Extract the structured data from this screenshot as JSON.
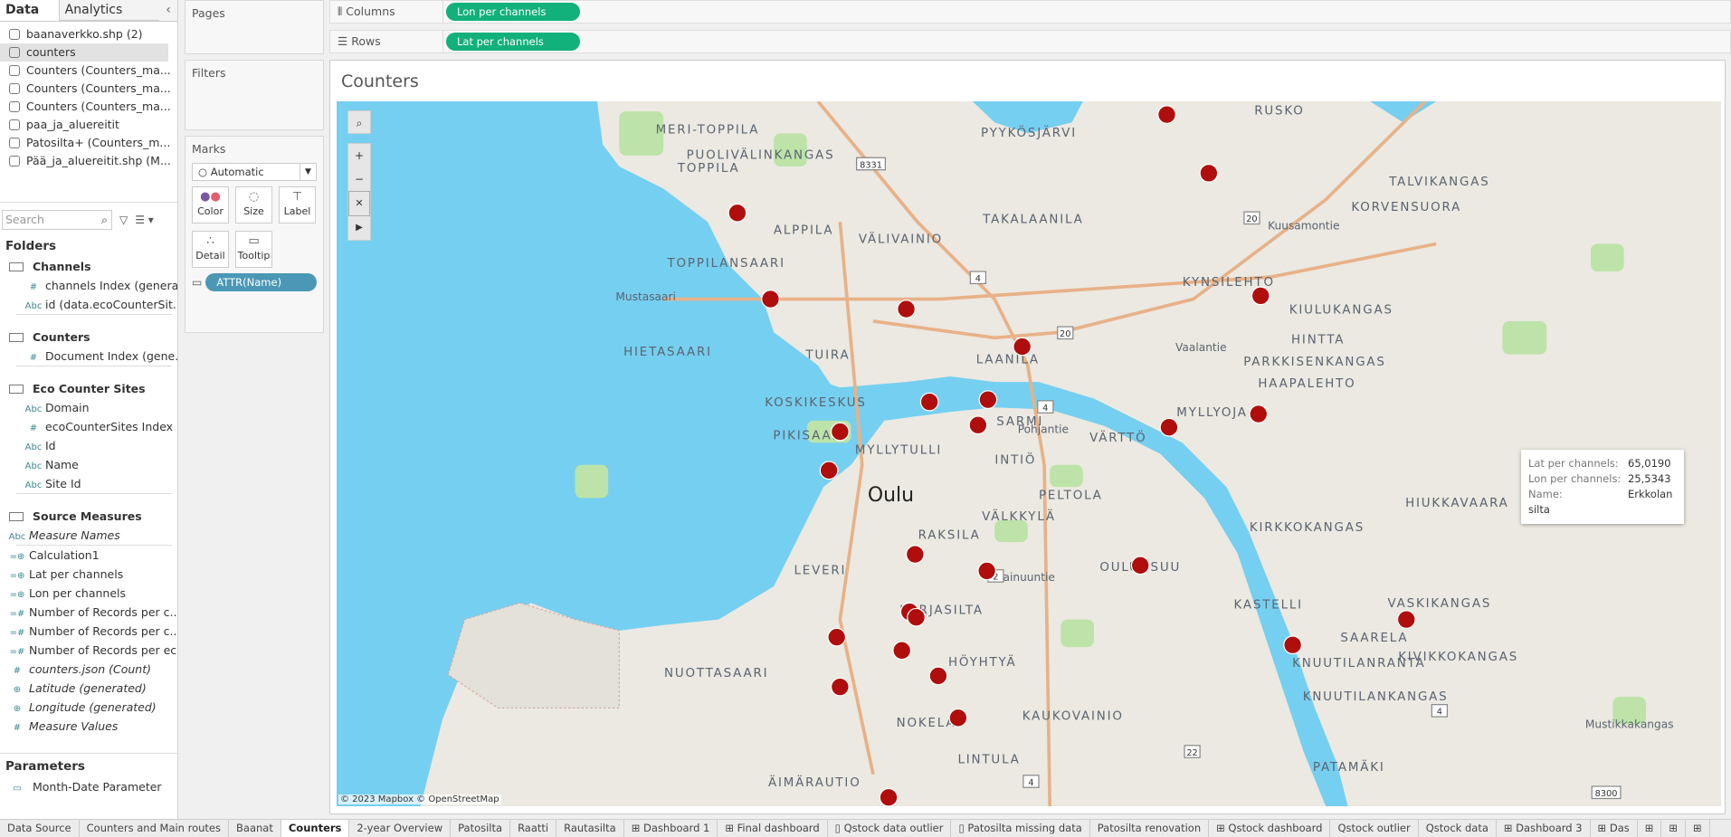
{
  "left": {
    "tabs": {
      "data": "Data",
      "analytics": "Analytics"
    },
    "datasources": [
      "baanaverkko.shp (2)",
      "counters",
      "Counters (Counters_ma...",
      "Counters (Counters_ma...",
      "Counters (Counters_ma...",
      "paa_ja_aluereitit",
      "Patosilta+ (Counters_m...",
      "Pää_ja_aluereitit.shp (M..."
    ],
    "search_placeholder": "Search",
    "folders_title": "Folders",
    "channels": {
      "name": "Channels",
      "fields": [
        {
          "type": "#",
          "name": "channels Index (genera..."
        },
        {
          "type": "Abc",
          "name": "id (data.ecoCounterSit..."
        }
      ]
    },
    "counters": {
      "name": "Counters",
      "fields": [
        {
          "type": "#",
          "name": "Document Index (gene..."
        }
      ]
    },
    "eco": {
      "name": "Eco Counter Sites",
      "fields": [
        {
          "type": "Abc",
          "name": "Domain"
        },
        {
          "type": "#",
          "name": "ecoCounterSites Index ..."
        },
        {
          "type": "Abc",
          "name": "Id"
        },
        {
          "type": "Abc",
          "name": "Name"
        },
        {
          "type": "Abc",
          "name": "Site Id"
        }
      ]
    },
    "source": {
      "name": "Source Measures",
      "measure_names": "Measure Names",
      "fields": [
        {
          "type": "=⊕",
          "name": "Calculation1"
        },
        {
          "type": "=⊕",
          "name": "Lat per channels"
        },
        {
          "type": "=⊕",
          "name": "Lon per channels"
        },
        {
          "type": "=#",
          "name": "Number of Records per c..."
        },
        {
          "type": "=#",
          "name": "Number of Records per c..."
        },
        {
          "type": "=#",
          "name": "Number of Records per ec..."
        },
        {
          "type": "#",
          "name": "counters.json (Count)"
        },
        {
          "type": "⊕",
          "name": "Latitude (generated)"
        },
        {
          "type": "⊕",
          "name": "Longitude (generated)"
        },
        {
          "type": "#",
          "name": "Measure Values"
        }
      ]
    },
    "parameters_title": "Parameters",
    "parameter": "Month-Date Parameter"
  },
  "shelves": {
    "pages": "Pages",
    "filters": "Filters",
    "marks": "Marks",
    "mark_type": "Automatic",
    "color": "Color",
    "size": "Size",
    "label": "Label",
    "detail": "Detail",
    "tooltip": "Tooltip",
    "attr_pill": "ATTR(Name)",
    "columns": "Columns",
    "rows": "Rows",
    "columns_pill": "Lon per channels",
    "rows_pill": "Lat per channels"
  },
  "view": {
    "title": "Counters",
    "copyright": "© 2023 Mapbox © OpenStreetMap"
  },
  "map": {
    "labels": [
      "RUSKO",
      "PYYKÖSJÄRVI",
      "MERI-TOPPILA",
      "TOPPILA",
      "PUOLIVÄLINKANGAS",
      "TALVIKANGAS",
      "KORVENSUORA",
      "ALPPILA",
      "VÄLIVAINIO",
      "TAKALAANILA",
      "TOPPILANSAARI",
      "Mustasaari",
      "KYNSILEHTO",
      "KIULUKANGAS",
      "HINTTA",
      "TUIRA",
      "LAANILA",
      "PARKKISENKANGAS",
      "HIETASAARI",
      "HAAPALEHTO",
      "KOSKIKESKUS",
      "SARMI",
      "MYLLYOJA",
      "PIKISAARI",
      "MYLLYTULLI",
      "VÄRTTÖ",
      "INTIÖ",
      "Oulu",
      "PELTOLA",
      "HIUKKAVAARA",
      "VÄLKKYLÄ",
      "KIRKKOKANGAS",
      "RAKSILA",
      "OULUNSUU",
      "LEVERI",
      "KARJASILTA",
      "VASKIKANGAS",
      "KASTELLI",
      "SAARELA",
      "NUOTTASAARI",
      "HÖYHTYÄ",
      "KNUUTILANRANTA",
      "KIVIKKOKANGAS",
      "KNUUTILANKANGAS",
      "NOKELA",
      "KAUKOVAINIO",
      "Mustikkakangas",
      "LINTULA",
      "PATAMÄKI",
      "ÄIMÄRAUTIO",
      "Kuusamontie",
      "Vaalantie",
      "Pohjantie",
      "Kainuuntie"
    ],
    "road_shields": [
      "4",
      "4",
      "4",
      "20",
      "20",
      "4",
      "2",
      "22",
      "4",
      "8300",
      "8331"
    ],
    "marker_color": "#b00d0d",
    "water_color": "#75cff0",
    "land_color": "#ebe9e1",
    "park_color": "#bde3a8"
  },
  "tooltip": {
    "lat_label": "Lat per channels:",
    "lat_value": "65,0190",
    "lon_label": "Lon per channels:",
    "lon_value": "25,5343",
    "name_label": "Name:",
    "name_value": "Erkkolan silta"
  },
  "tabs": [
    {
      "label": "Data Source"
    },
    {
      "label": "Counters and Main routes"
    },
    {
      "label": "Baanat"
    },
    {
      "label": "Counters",
      "active": true
    },
    {
      "label": "2-year Overview"
    },
    {
      "label": "Patosilta"
    },
    {
      "label": "Raatti"
    },
    {
      "label": "Rautasilta"
    },
    {
      "label": "⊞ Dashboard 1"
    },
    {
      "label": "⊞ Final dashboard"
    },
    {
      "label": "▯ Qstock data outlier"
    },
    {
      "label": "▯ Patosilta missing data"
    },
    {
      "label": "Patosilta renovation"
    },
    {
      "label": "⊞ Qstock dashboard"
    },
    {
      "label": "Qstock outlier"
    },
    {
      "label": "Qstock data"
    },
    {
      "label": "⊞ Dashboard 3"
    },
    {
      "label": "⊞ Das"
    }
  ],
  "colors": {
    "pill_green": "#12b07a",
    "pill_blue": "#4a98b5"
  }
}
